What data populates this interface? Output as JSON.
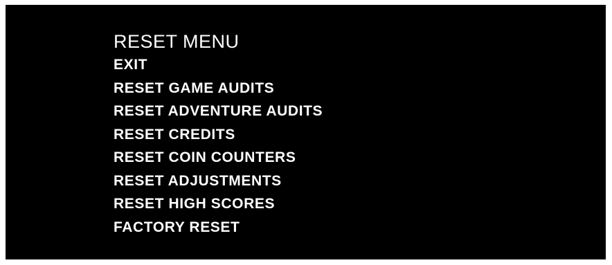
{
  "colors": {
    "background": "#000000",
    "text": "#ffffff",
    "frame": "#ffffff"
  },
  "menu": {
    "title": "RESET MENU",
    "items": [
      {
        "label": "EXIT"
      },
      {
        "label": "RESET GAME AUDITS"
      },
      {
        "label": "RESET ADVENTURE AUDITS"
      },
      {
        "label": "RESET CREDITS"
      },
      {
        "label": "RESET COIN COUNTERS"
      },
      {
        "label": "RESET ADJUSTMENTS"
      },
      {
        "label": "RESET HIGH SCORES"
      },
      {
        "label": "FACTORY RESET"
      }
    ]
  }
}
